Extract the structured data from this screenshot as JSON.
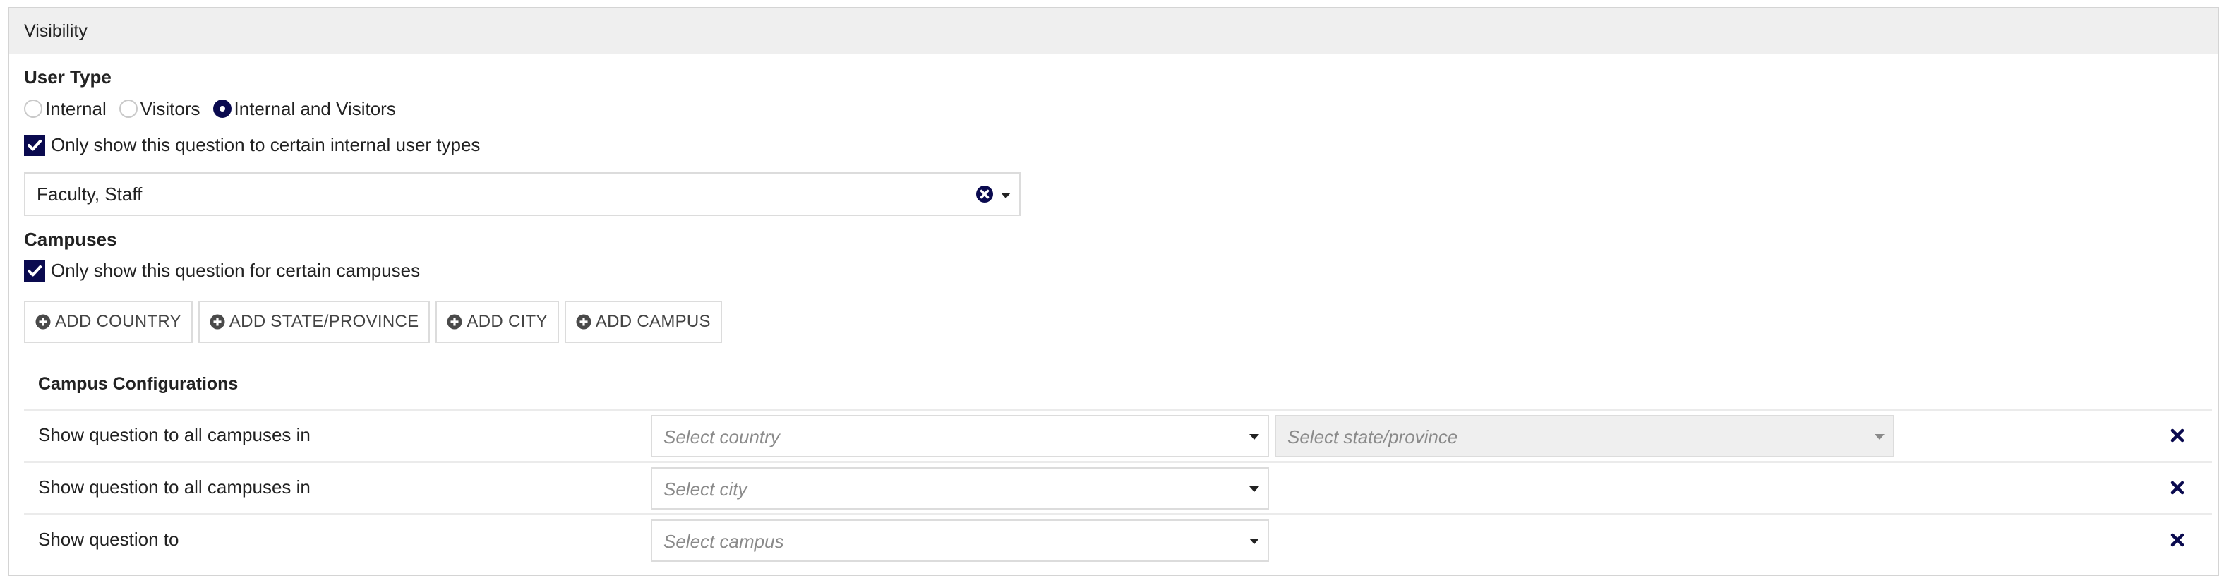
{
  "panel": {
    "title": "Visibility"
  },
  "user_type": {
    "label": "User Type",
    "options": [
      {
        "label": "Internal",
        "checked": false
      },
      {
        "label": "Visitors",
        "checked": false
      },
      {
        "label": "Internal and Visitors",
        "checked": true
      }
    ],
    "restrict_checkbox": {
      "label": "Only show this question to certain internal user types",
      "checked": true
    },
    "selected_user_types": "Faculty, Staff"
  },
  "campuses": {
    "label": "Campuses",
    "restrict_checkbox": {
      "label": "Only show this question for certain campuses",
      "checked": true
    },
    "buttons": [
      {
        "label": "ADD COUNTRY",
        "icon": "plus-circle-icon"
      },
      {
        "label": "ADD STATE/PROVINCE",
        "icon": "plus-circle-icon"
      },
      {
        "label": "ADD CITY",
        "icon": "plus-circle-icon"
      },
      {
        "label": "ADD CAMPUS",
        "icon": "plus-circle-icon"
      }
    ]
  },
  "campus_configurations": {
    "title": "Campus Configurations",
    "rows": [
      {
        "label": "Show question to all campuses in",
        "selects": [
          {
            "placeholder": "Select country",
            "disabled": false
          },
          {
            "placeholder": "Select state/province",
            "disabled": true
          }
        ]
      },
      {
        "label": "Show question to all campuses in",
        "selects": [
          {
            "placeholder": "Select city",
            "disabled": false
          }
        ]
      },
      {
        "label": "Show question to",
        "selects": [
          {
            "placeholder": "Select campus",
            "disabled": false
          }
        ]
      }
    ]
  },
  "colors": {
    "accent": "#0a0a4f",
    "header_bg": "#efefef",
    "border": "#dcdcdc",
    "disabled_bg": "#efefef"
  }
}
